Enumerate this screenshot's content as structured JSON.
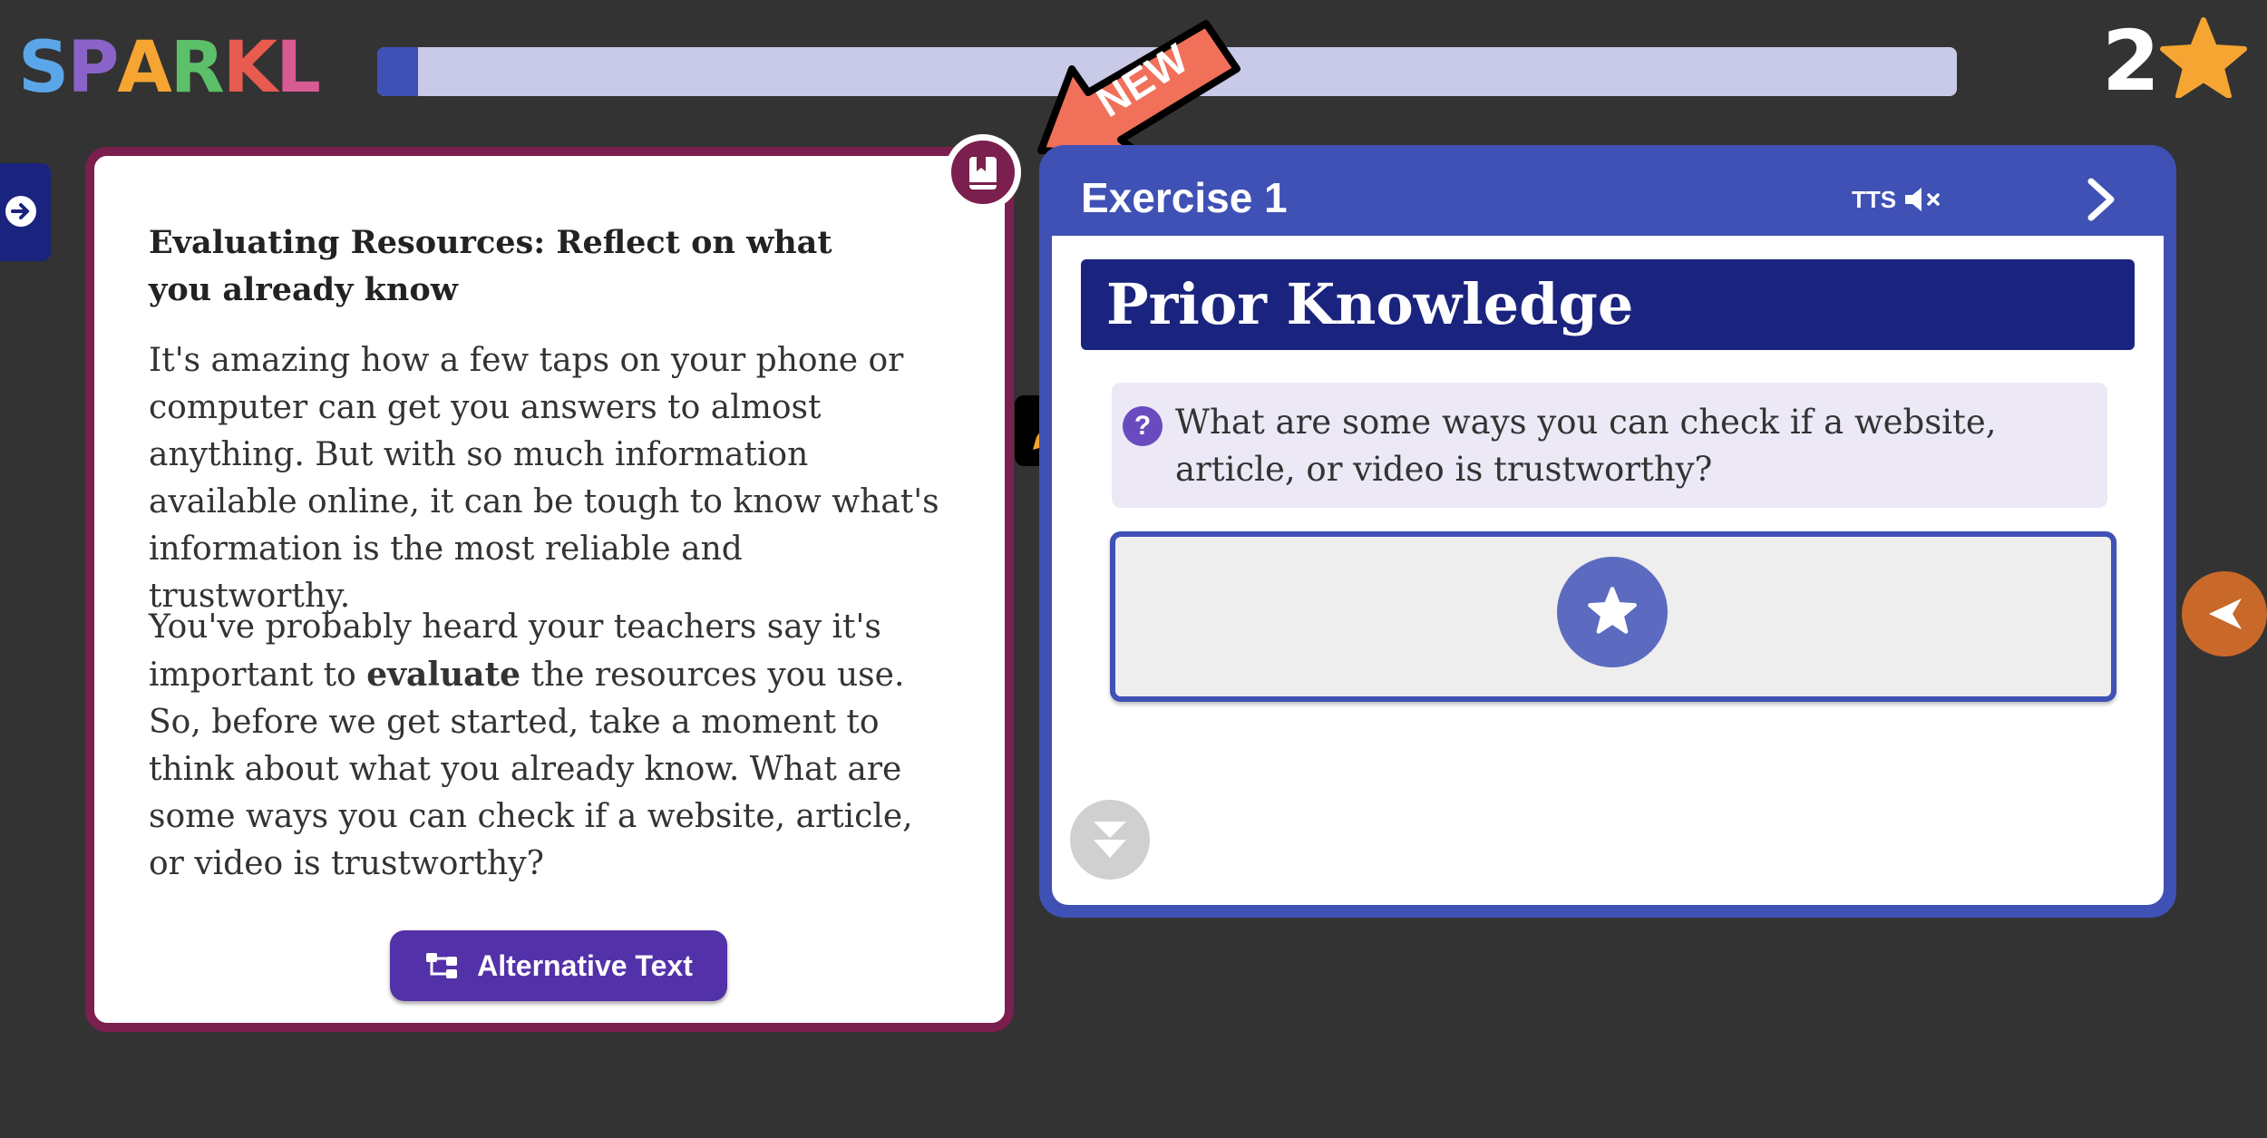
{
  "header": {
    "logo_letters": [
      {
        "char": "S",
        "color": "#5aa6e8"
      },
      {
        "char": "P",
        "color": "#8a63c9"
      },
      {
        "char": "A",
        "color": "#f6a532"
      },
      {
        "char": "R",
        "color": "#5cbf6a"
      },
      {
        "char": "K",
        "color": "#e85b4f"
      },
      {
        "char": "L",
        "color": "#d95b94"
      }
    ],
    "progress_fraction": 0.026,
    "star_count": "2"
  },
  "new_badge": {
    "label": "NEW",
    "color": "#f0705a"
  },
  "reading": {
    "title": "Evaluating Resources: Reflect on what you already know",
    "paragraph1": "It's amazing how a few taps on your phone or computer can get you answers to almost anything. But with so much information available online, it can be tough to know what's information is the most reliable and trustworthy.",
    "paragraph2_before": "You've probably heard your teachers say it's important to ",
    "paragraph2_bold": "evaluate",
    "paragraph2_after": " the resources you use. So, before we get started, take a moment to think about what you already know. What are some ways you can check if a website, article, or video is trustworthy?",
    "alt_button_label": "Alternative Text"
  },
  "exercise": {
    "title": "Exercise 1",
    "tts_label": "TTS",
    "section_title": "Prior Knowledge",
    "question_icon": "?",
    "question": "What are some ways you can check if a website, article, or video is trustworthy?"
  },
  "icons": {
    "star": "star-icon",
    "arrow_right_circle": "arrow-right-circle-icon",
    "bookmark": "bookmark-icon",
    "highlighter": "highlighter-icon",
    "speaker_muted": "speaker-muted-icon",
    "chevron_right": "chevron-right-icon",
    "chevron_left": "chevron-left-icon",
    "hierarchy": "hierarchy-icon",
    "double_chevron_down": "double-chevron-down-icon"
  },
  "colors": {
    "accent_blue": "#3f51b5",
    "navy": "#1a237e",
    "maroon": "#7b1f4e",
    "purple_button": "#5331a8",
    "star_yellow": "#f6a532"
  }
}
